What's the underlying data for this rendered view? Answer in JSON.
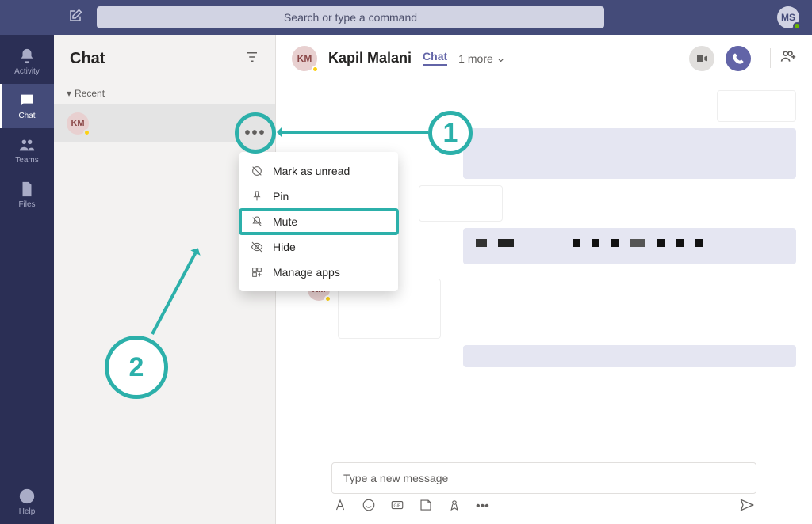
{
  "topbar": {
    "search_placeholder": "Search or type a command",
    "profile_initials": "MS"
  },
  "rail": {
    "activity": "Activity",
    "chat": "Chat",
    "teams": "Teams",
    "files": "Files",
    "help": "Help"
  },
  "chatlist": {
    "title": "Chat",
    "recent_label": "Recent",
    "item0_initials": "KM"
  },
  "chatheader": {
    "avatar_initials": "KM",
    "name": "Kapil Malani",
    "tab_chat": "Chat",
    "one_more": "1 more"
  },
  "msg_avatar_initials": "KM",
  "compose": {
    "placeholder": "Type a new message"
  },
  "context_menu": {
    "mark_as_unread": "Mark as unread",
    "pin": "Pin",
    "mute": "Mute",
    "hide": "Hide",
    "manage_apps": "Manage apps"
  },
  "callouts": {
    "one": "1",
    "two": "2",
    "ellipsis": "•••"
  }
}
